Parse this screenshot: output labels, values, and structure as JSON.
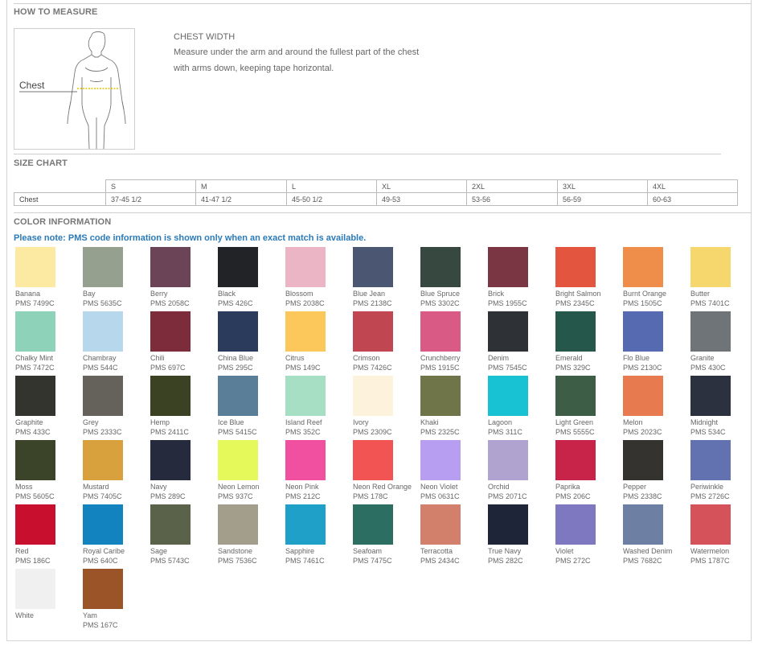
{
  "how_to_measure": {
    "title": "HOW TO MEASURE",
    "figure_label": "Chest",
    "heading": "CHEST WIDTH",
    "line1": "Measure under the arm and around the fullest part of the chest",
    "line2": "with arms down, keeping tape horizontal."
  },
  "size_chart": {
    "title": "SIZE CHART",
    "headers": [
      "S",
      "M",
      "L",
      "XL",
      "2XL",
      "3XL",
      "4XL"
    ],
    "row_label": "Chest",
    "values": [
      "37-45 1/2",
      "41-47 1/2",
      "45-50 1/2",
      "49-53",
      "53-56",
      "56-59",
      "60-63"
    ]
  },
  "color_info": {
    "title": "COLOR INFORMATION",
    "note": "Please note: PMS code information is shown only when an exact match is available.",
    "colors": [
      {
        "name": "Banana",
        "pms": "PMS 7499C",
        "hex": "#fdeaa2"
      },
      {
        "name": "Bay",
        "pms": "PMS 5635C",
        "hex": "#95a18e"
      },
      {
        "name": "Berry",
        "pms": "PMS 2058C",
        "hex": "#6b4457"
      },
      {
        "name": "Black",
        "pms": "PMS 426C",
        "hex": "#222326"
      },
      {
        "name": "Blossom",
        "pms": "PMS 2038C",
        "hex": "#ecb5c6"
      },
      {
        "name": "Blue Jean",
        "pms": "PMS 2138C",
        "hex": "#4b5672"
      },
      {
        "name": "Blue Spruce",
        "pms": "PMS 3302C",
        "hex": "#364840"
      },
      {
        "name": "Brick",
        "pms": "PMS 1955C",
        "hex": "#7a3642"
      },
      {
        "name": "Bright Salmon",
        "pms": "PMS 2345C",
        "hex": "#e3553f"
      },
      {
        "name": "Burnt Orange",
        "pms": "PMS 1505C",
        "hex": "#ef8d4b"
      },
      {
        "name": "Butter",
        "pms": "PMS 7401C",
        "hex": "#f5d76e"
      },
      {
        "name": "Chalky Mint",
        "pms": "PMS 7472C",
        "hex": "#8ed2b9"
      },
      {
        "name": "Chambray",
        "pms": "PMS 544C",
        "hex": "#b7d8ec"
      },
      {
        "name": "Chili",
        "pms": "PMS 697C",
        "hex": "#7c2c3b"
      },
      {
        "name": "China Blue",
        "pms": "PMS 295C",
        "hex": "#2b3b5c"
      },
      {
        "name": "Citrus",
        "pms": "PMS 149C",
        "hex": "#fcc85b"
      },
      {
        "name": "Crimson",
        "pms": "PMS 7426C",
        "hex": "#c04652"
      },
      {
        "name": "Crunchberry",
        "pms": "PMS 1915C",
        "hex": "#d95a84"
      },
      {
        "name": "Denim",
        "pms": "PMS 7545C",
        "hex": "#2e3236"
      },
      {
        "name": "Emerald",
        "pms": "PMS 329C",
        "hex": "#25574a"
      },
      {
        "name": "Flo Blue",
        "pms": "PMS 2130C",
        "hex": "#566ab2"
      },
      {
        "name": "Granite",
        "pms": "PMS 430C",
        "hex": "#6f7478"
      },
      {
        "name": "Graphite",
        "pms": "PMS 433C",
        "hex": "#34342f"
      },
      {
        "name": "Grey",
        "pms": "PMS 2333C",
        "hex": "#65625c"
      },
      {
        "name": "Hemp",
        "pms": "PMS 2411C",
        "hex": "#3a4223"
      },
      {
        "name": "Ice Blue",
        "pms": "PMS 5415C",
        "hex": "#5a7d98"
      },
      {
        "name": "Island Reef",
        "pms": "PMS 352C",
        "hex": "#a6dfc4"
      },
      {
        "name": "Ivory",
        "pms": "PMS 2309C",
        "hex": "#fdf3dc"
      },
      {
        "name": "Khaki",
        "pms": "PMS 2325C",
        "hex": "#6f7449"
      },
      {
        "name": "Lagoon",
        "pms": "PMS 311C",
        "hex": "#19c2d2"
      },
      {
        "name": "Light Green",
        "pms": "PMS 5555C",
        "hex": "#3d5d47"
      },
      {
        "name": "Melon",
        "pms": "PMS 2023C",
        "hex": "#e77b4f"
      },
      {
        "name": "Midnight",
        "pms": "PMS 534C",
        "hex": "#2c3140"
      },
      {
        "name": "Moss",
        "pms": "PMS 5605C",
        "hex": "#3b4428"
      },
      {
        "name": "Mustard",
        "pms": "PMS 7405C",
        "hex": "#d9a03e"
      },
      {
        "name": "Navy",
        "pms": "PMS 289C",
        "hex": "#252a3d"
      },
      {
        "name": "Neon Lemon",
        "pms": "PMS 937C",
        "hex": "#e6f95a"
      },
      {
        "name": "Neon Pink",
        "pms": "PMS 212C",
        "hex": "#f150a0"
      },
      {
        "name": "Neon Red Orange",
        "pms": "PMS 178C",
        "hex": "#f25454"
      },
      {
        "name": "Neon Violet",
        "pms": "PMS 0631C",
        "hex": "#b79ef0"
      },
      {
        "name": "Orchid",
        "pms": "PMS 2071C",
        "hex": "#b0a3cf"
      },
      {
        "name": "Paprika",
        "pms": "PMS 206C",
        "hex": "#c8244a"
      },
      {
        "name": "Pepper",
        "pms": "PMS 2338C",
        "hex": "#35332f"
      },
      {
        "name": "Periwinkle",
        "pms": "PMS 2726C",
        "hex": "#6271b0"
      },
      {
        "name": "Red",
        "pms": "PMS 186C",
        "hex": "#c8102e"
      },
      {
        "name": "Royal Caribe",
        "pms": "PMS 640C",
        "hex": "#1383c0"
      },
      {
        "name": "Sage",
        "pms": "PMS 5743C",
        "hex": "#5a6349"
      },
      {
        "name": "Sandstone",
        "pms": "PMS 7536C",
        "hex": "#a39e8c"
      },
      {
        "name": "Sapphire",
        "pms": "PMS 7461C",
        "hex": "#1ea0c8"
      },
      {
        "name": "Seafoam",
        "pms": "PMS 7475C",
        "hex": "#2c6e62"
      },
      {
        "name": "Terracotta",
        "pms": "PMS 2434C",
        "hex": "#d27f6b"
      },
      {
        "name": "True Navy",
        "pms": "PMS 282C",
        "hex": "#1f2538"
      },
      {
        "name": "Violet",
        "pms": "PMS 272C",
        "hex": "#7e78c0"
      },
      {
        "name": "Washed Denim",
        "pms": "PMS 7682C",
        "hex": "#6d7fa3"
      },
      {
        "name": "Watermelon",
        "pms": "PMS 1787C",
        "hex": "#d6525a"
      },
      {
        "name": "White",
        "pms": "",
        "hex": "#f0f0f0"
      },
      {
        "name": "Yam",
        "pms": "PMS 167C",
        "hex": "#9a5427"
      }
    ]
  }
}
